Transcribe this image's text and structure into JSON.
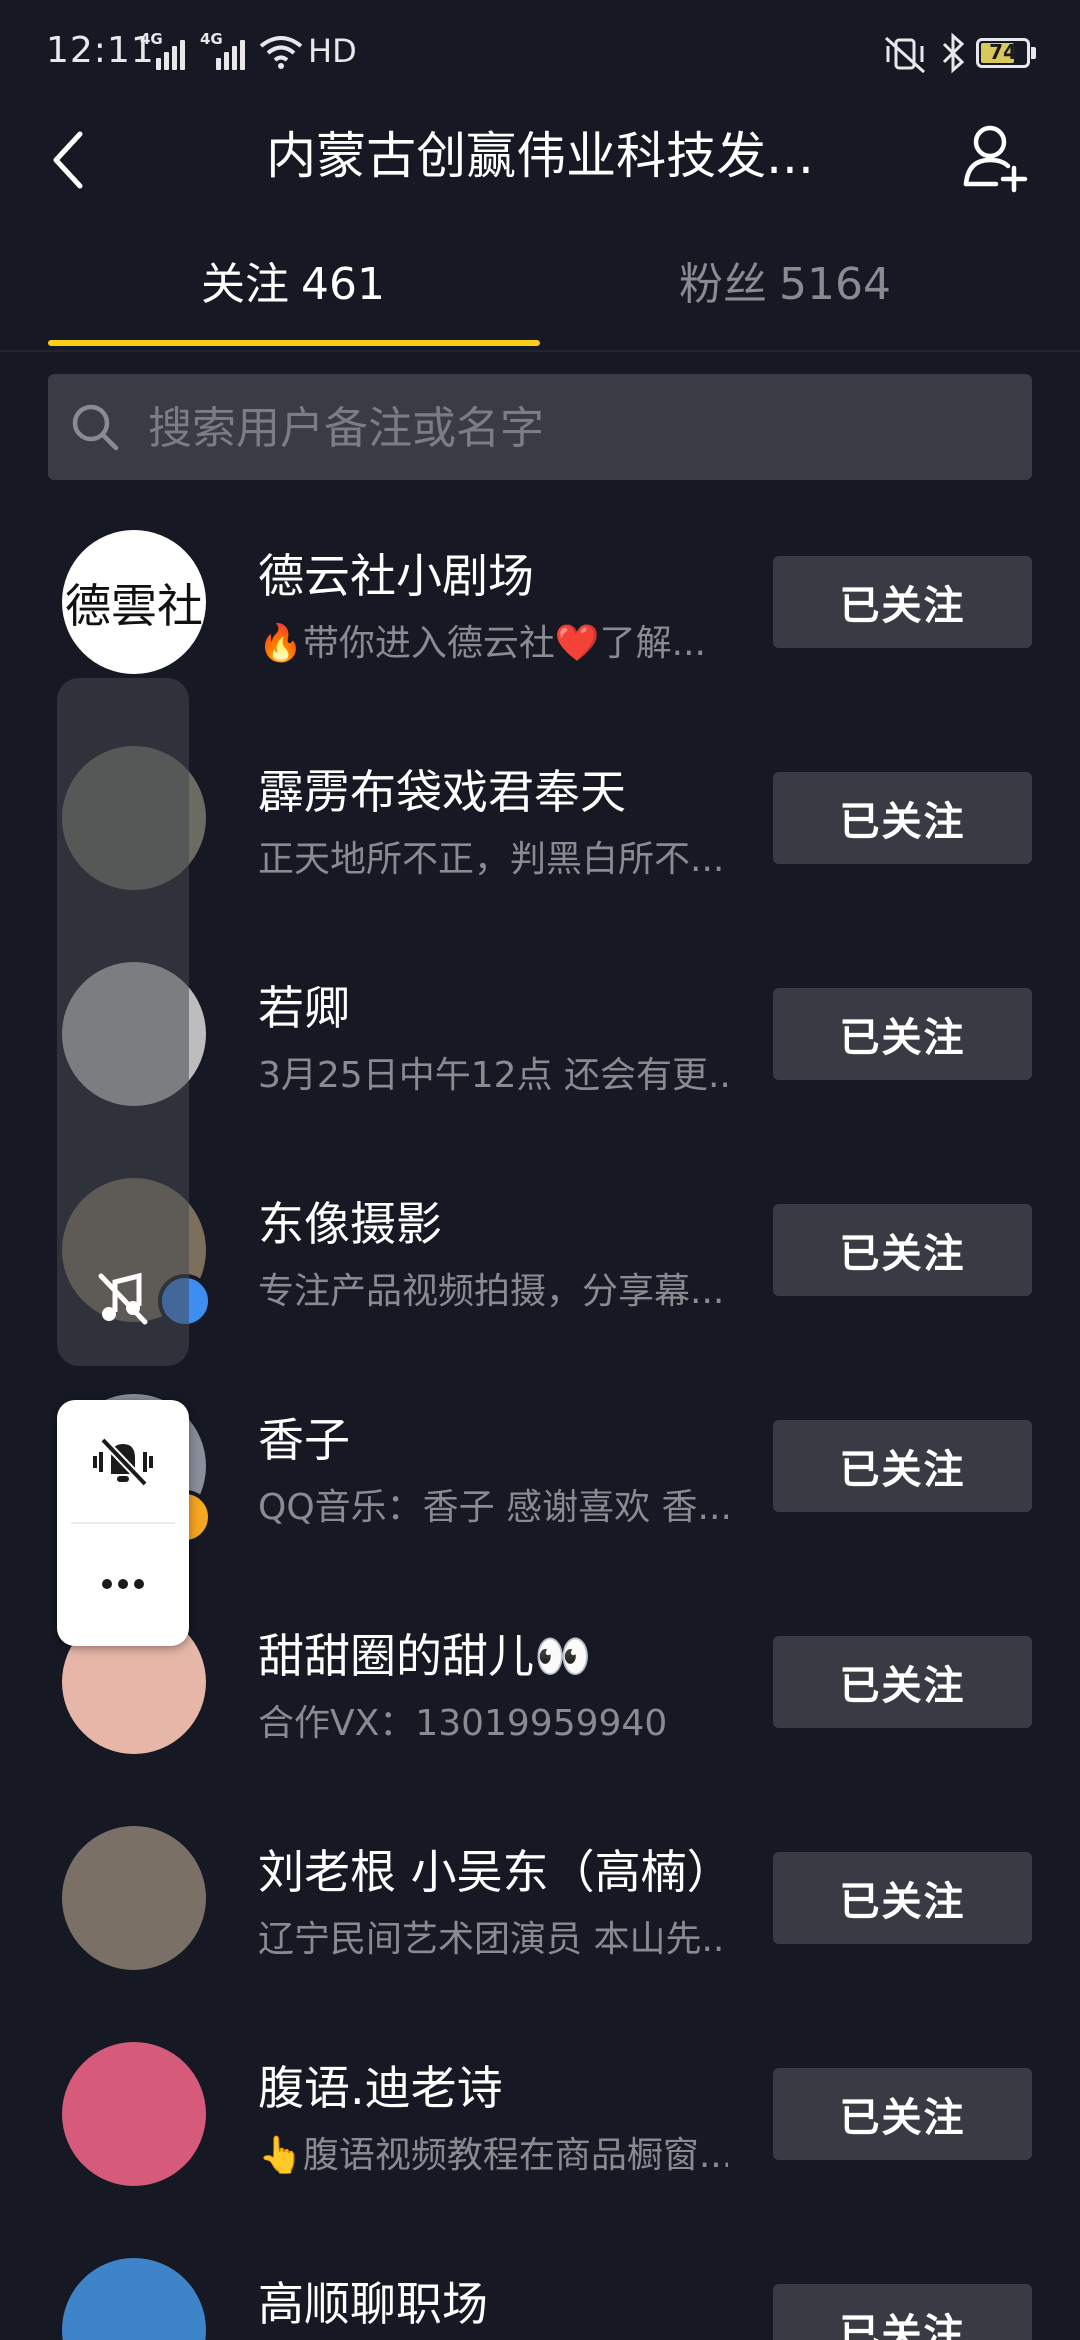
{
  "status_bar": {
    "time": "12:11",
    "signal1_label": "4G",
    "signal2_label": "4G",
    "hd_label": "HD",
    "battery": "74",
    "battery_level": 0.74
  },
  "header": {
    "title": "内蒙古创赢伟业科技发...",
    "back_icon": "chevron-left-icon",
    "add_icon": "add-user-icon"
  },
  "tabs": [
    {
      "label": "关注",
      "count": "461"
    },
    {
      "label": "粉丝",
      "count": "5164"
    }
  ],
  "search": {
    "placeholder": "搜索用户备注或名字"
  },
  "follow_label": "已关注",
  "users": [
    {
      "name": "德云社小剧场",
      "desc": "🔥带你进入德云社❤️了解...",
      "avatar_text": "德雲社",
      "avatar_color": "#ffffff"
    },
    {
      "name": "霹雳布袋戏君奉天",
      "desc": "正天地所不正，判黑白所不...",
      "avatar_text": "",
      "avatar_color": "#6b6b62"
    },
    {
      "name": "若卿",
      "desc": "3月25日中午12点 还会有更...",
      "avatar_text": "",
      "avatar_color": "#bdbdbd"
    },
    {
      "name": "东像摄影",
      "desc": "专注产品视频拍摄，分享幕...",
      "avatar_text": "",
      "avatar_color": "#7d6f5e",
      "badge": "#3d8ef0"
    },
    {
      "name": "香子",
      "desc": "QQ音乐：香子 感谢喜欢 香...",
      "avatar_text": "",
      "avatar_color": "#8a8e9a",
      "badge": "#f5a623"
    },
    {
      "name": "甜甜圈的甜儿👀",
      "desc": "合作VX：13019959940",
      "avatar_text": "",
      "avatar_color": "#e6b7a9"
    },
    {
      "name": "刘老根 小吴东（高楠）",
      "desc": "辽宁民间艺术团演员 本山先...",
      "avatar_text": "",
      "avatar_color": "#7a7066"
    },
    {
      "name": "腹语.迪老诗",
      "desc": "👆腹语视频教程在商品橱窗...",
      "avatar_text": "",
      "avatar_color": "#d65a7a"
    },
    {
      "name": "高顺聊职场",
      "desc": "",
      "avatar_text": "",
      "avatar_color": "#3e84c8"
    }
  ],
  "colors": {
    "background": "#161823",
    "accent": "#face15",
    "button_bg": "#393b44"
  }
}
